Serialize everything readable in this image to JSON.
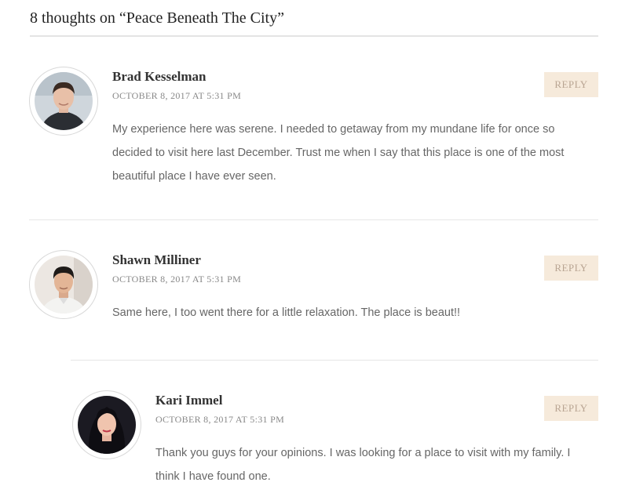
{
  "comments_heading": "8 thoughts on “Peace Beneath The City”",
  "comments": [
    {
      "author": "Brad Kesselman",
      "date": "OCTOBER 8, 2017 AT 5:31 PM",
      "reply_label": "REPLY",
      "text": "My experience here was serene. I needed to getaway from my mundane life for once so decided to visit here last December. Trust me when I say that this place is one of the most beautiful place I have ever seen."
    },
    {
      "author": "Shawn Milliner",
      "date": "OCTOBER 8, 2017 AT 5:31 PM",
      "reply_label": "REPLY",
      "text": "Same here, I too went there for a little relaxation. The place is beaut!!"
    },
    {
      "author": "Kari Immel",
      "date": "OCTOBER 8, 2017 AT 5:31 PM",
      "reply_label": "REPLY",
      "text": "Thank you guys for your opinions. I was looking for a place to visit with my family. I think I have found one."
    }
  ],
  "colors": {
    "reply_bg": "#f6eadb",
    "reply_text": "#b9a593",
    "divider": "#e6e6e6"
  }
}
